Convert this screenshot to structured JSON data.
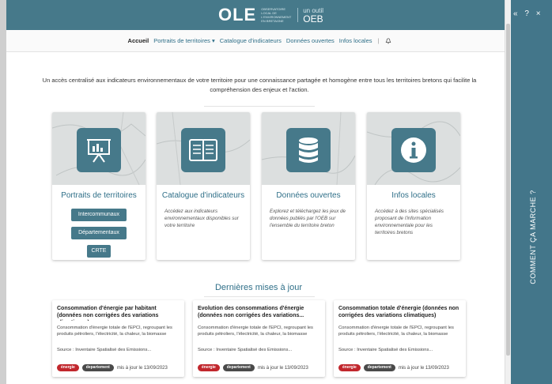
{
  "brand": {
    "logo_text": "OLE",
    "logo_subtitle": "Observatoire local de l'environnement en Bretagne",
    "partner_small": "un outil",
    "partner_name": "OEB"
  },
  "nav": {
    "items": [
      {
        "label": "Accueil",
        "active": true
      },
      {
        "label": "Portraits de territoires ▾",
        "active": false
      },
      {
        "label": "Catalogue d'indicateurs",
        "active": false
      },
      {
        "label": "Données ouvertes",
        "active": false
      },
      {
        "label": "Infos locales",
        "active": false
      }
    ],
    "divider": "|",
    "bell_icon": "bell-icon"
  },
  "intro": {
    "text": "Un accès centralisé aux indicateurs environnementaux de votre territoire pour une connaissance partagée et homogène entre tous les territoires bretons qui facilite la compréhension des enjeux et l'action."
  },
  "cards": [
    {
      "title": "Portraits de territoires",
      "icon": "presentation-board-icon",
      "buttons": [
        "Intercommunaux",
        "Départementaux",
        "CRTE"
      ]
    },
    {
      "title": "Catalogue d'indicateurs",
      "icon": "open-book-icon",
      "description": "Accédez aux indicateurs environnementaux disponibles sur votre territoire"
    },
    {
      "title": "Données ouvertes",
      "icon": "database-icon",
      "description": "Explorez et téléchargez les jeux de données publiés par l'OEB sur l'ensemble du territoire breton"
    },
    {
      "title": "Infos locales",
      "icon": "info-icon",
      "description": "Accédez à des sites spécialisés proposant de l'information environnementale pour les territoires bretons"
    }
  ],
  "updates": {
    "title": "Dernières mises à jour",
    "items": [
      {
        "title": "Consommation d'énergie par habitant (données non corrigées des variations climatiques)",
        "description": "Consommation d'énergie totale de l'EPCI, regroupant les produits pétroliers, l'électricité, la chaleur, la biomasse",
        "source": "Source : Inventaire Spatialisé des Emissions...",
        "tags": [
          "énergie",
          "departement"
        ],
        "updated": "mis à jour le 13/09/2023"
      },
      {
        "title": "Evolution des consommations d'énergie (données non corrigées des variations...",
        "description": "Consommation d'énergie totale de l'EPCI, regroupant les produits pétroliers, l'électricité, la chaleur, la biomasse",
        "source": "Source : Inventaire Spatialisé des Emissions...",
        "tags": [
          "énergie",
          "departement"
        ],
        "updated": "mis à jour le 13/09/2023"
      },
      {
        "title": "Consommation totale d'énergie (données non corrigées des variations climatiques)",
        "description": "Consommation d'énergie totale de l'EPCI, regroupant les produits pétroliers, l'électricité, la chaleur, la biomasse",
        "source": "Source : Inventaire Spatialisé des Emissions...",
        "tags": [
          "énergie",
          "departement"
        ],
        "updated": "mis à jour le 13/09/2023"
      }
    ]
  },
  "sidepanel": {
    "collapse": "«",
    "help": "?",
    "close": "×",
    "label": "COMMENT ÇA MARCHE ?"
  },
  "colors": {
    "primary": "#46798a",
    "link": "#2f6f88",
    "tag_red": "#c1272d",
    "tag_dark": "#4a4a4a"
  }
}
